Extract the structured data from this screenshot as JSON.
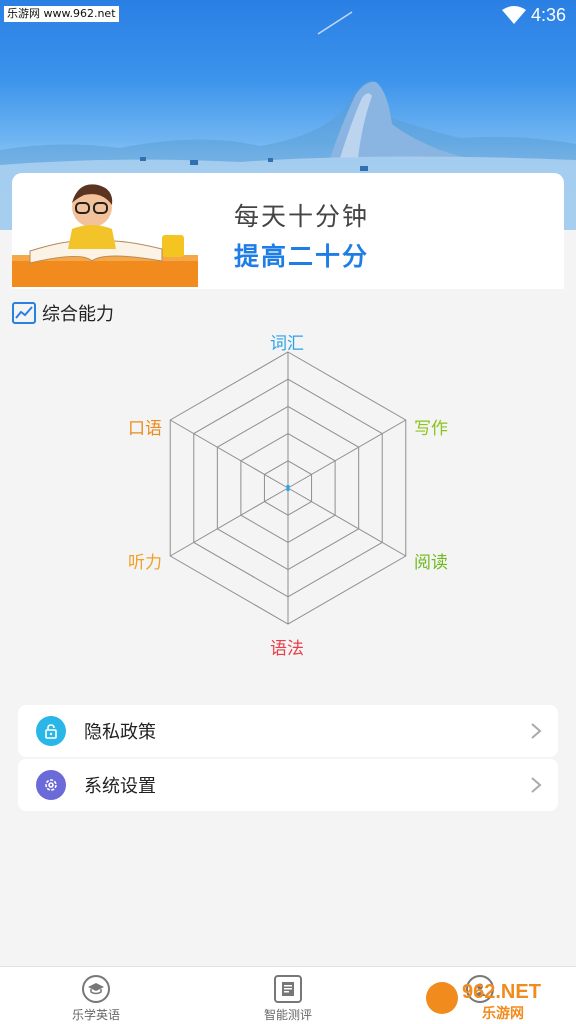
{
  "status_bar": {
    "watermark": "乐游网 www.962.net",
    "time": "4:36"
  },
  "banner": {
    "line1": "每天十分钟",
    "line2": "提高二十分"
  },
  "section": {
    "title": "综合能力"
  },
  "radar": {
    "axes": [
      {
        "label": "词汇",
        "color": "#2aa2e8"
      },
      {
        "label": "写作",
        "color": "#8cc41a"
      },
      {
        "label": "阅读",
        "color": "#6fba1c"
      },
      {
        "label": "语法",
        "color": "#e8404a"
      },
      {
        "label": "听力",
        "color": "#f0a12a"
      },
      {
        "label": "口语",
        "color": "#ee8a1c"
      }
    ],
    "rings": 5,
    "grid_color": "#8e8e8e",
    "point_color": "#2aa2e8"
  },
  "menu": [
    {
      "label": "隐私政策",
      "icon": "lock-icon",
      "icon_color": "#2bb6e8"
    },
    {
      "label": "系统设置",
      "icon": "gear-icon",
      "icon_color": "#6a6ad8"
    }
  ],
  "bottom_nav": [
    {
      "label": "乐学英语",
      "icon": "graduation-cap-icon"
    },
    {
      "label": "智能测评",
      "icon": "document-icon"
    },
    {
      "label": "",
      "icon": "user-icon"
    }
  ],
  "watermark_br": {
    "brand": "962.NET",
    "sub": "乐游网"
  }
}
